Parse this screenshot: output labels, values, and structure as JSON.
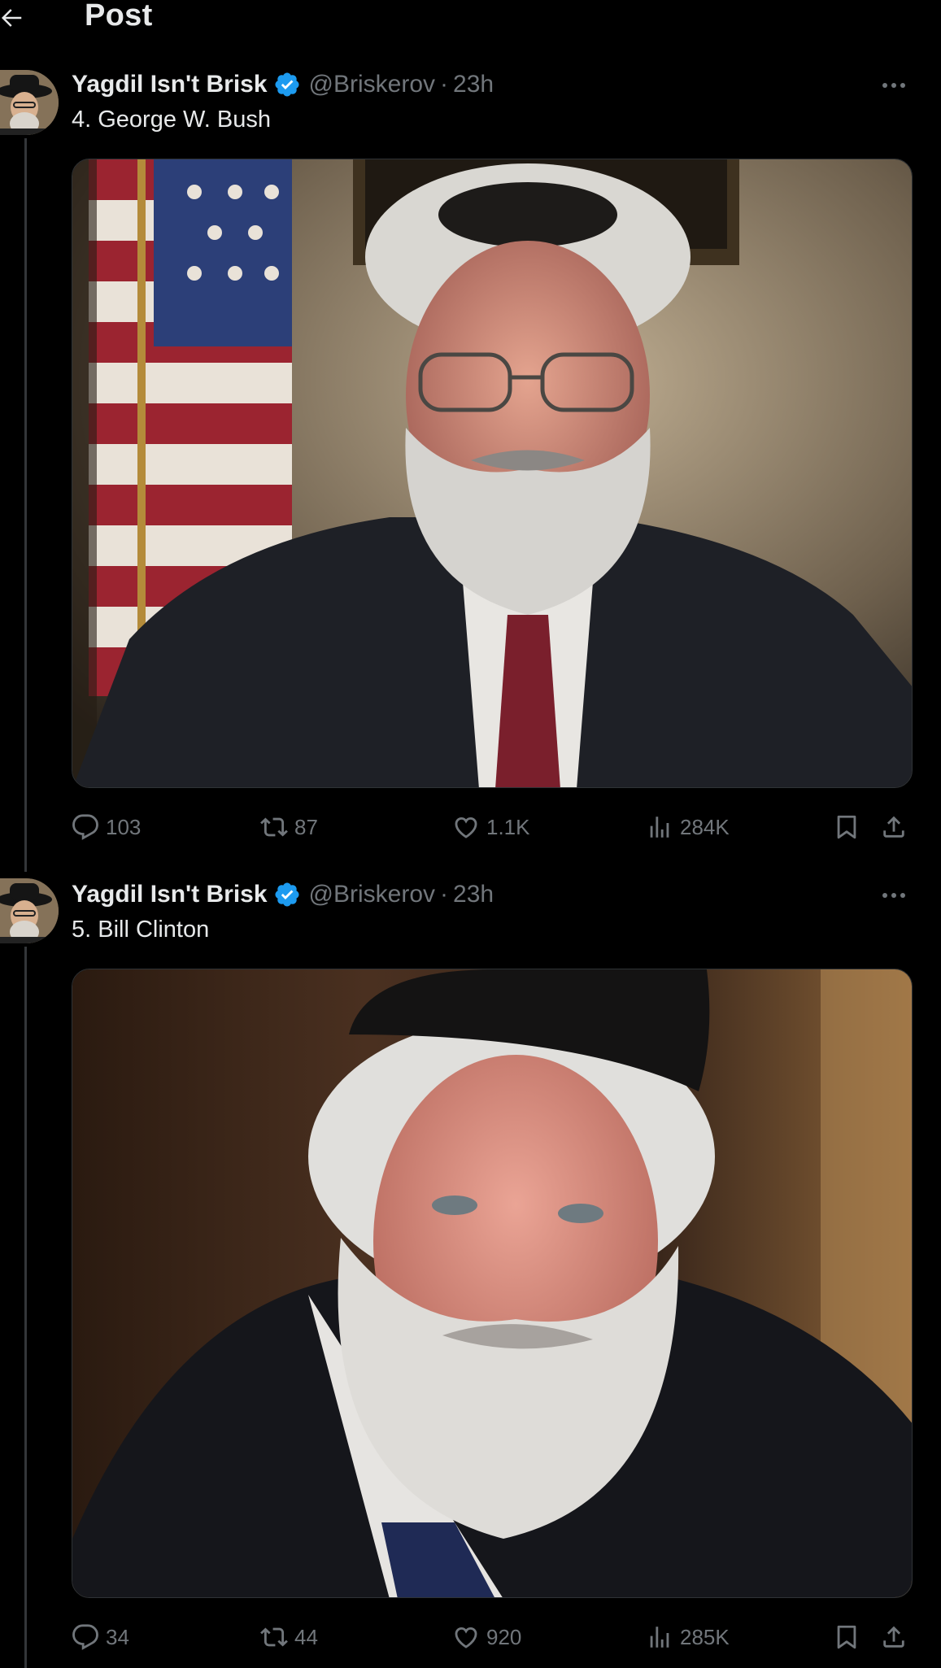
{
  "header": {
    "title": "Post"
  },
  "tweets": [
    {
      "author": "Yagdil Isn't Brisk",
      "handle": "@Briskerov",
      "time": "23h",
      "text": "4. George W. Bush",
      "stats": {
        "replies": "103",
        "reposts": "87",
        "likes": "1.1K",
        "views": "284K"
      }
    },
    {
      "author": "Yagdil Isn't Brisk",
      "handle": "@Briskerov",
      "time": "23h",
      "text": "5. Bill Clinton",
      "stats": {
        "replies": "34",
        "reposts": "44",
        "likes": "920",
        "views": "285K"
      }
    }
  ],
  "icons": {
    "back": "arrow-left-icon",
    "verified": "verified-badge-icon",
    "more": "more-icon",
    "reply": "reply-icon",
    "repost": "repost-icon",
    "like": "heart-icon",
    "views": "views-icon",
    "bookmark": "bookmark-icon",
    "share": "share-icon"
  },
  "colors": {
    "background": "#000000",
    "text": "#e7e9ea",
    "muted": "#71767b",
    "verified": "#1d9bf0",
    "border": "#2f3336"
  }
}
